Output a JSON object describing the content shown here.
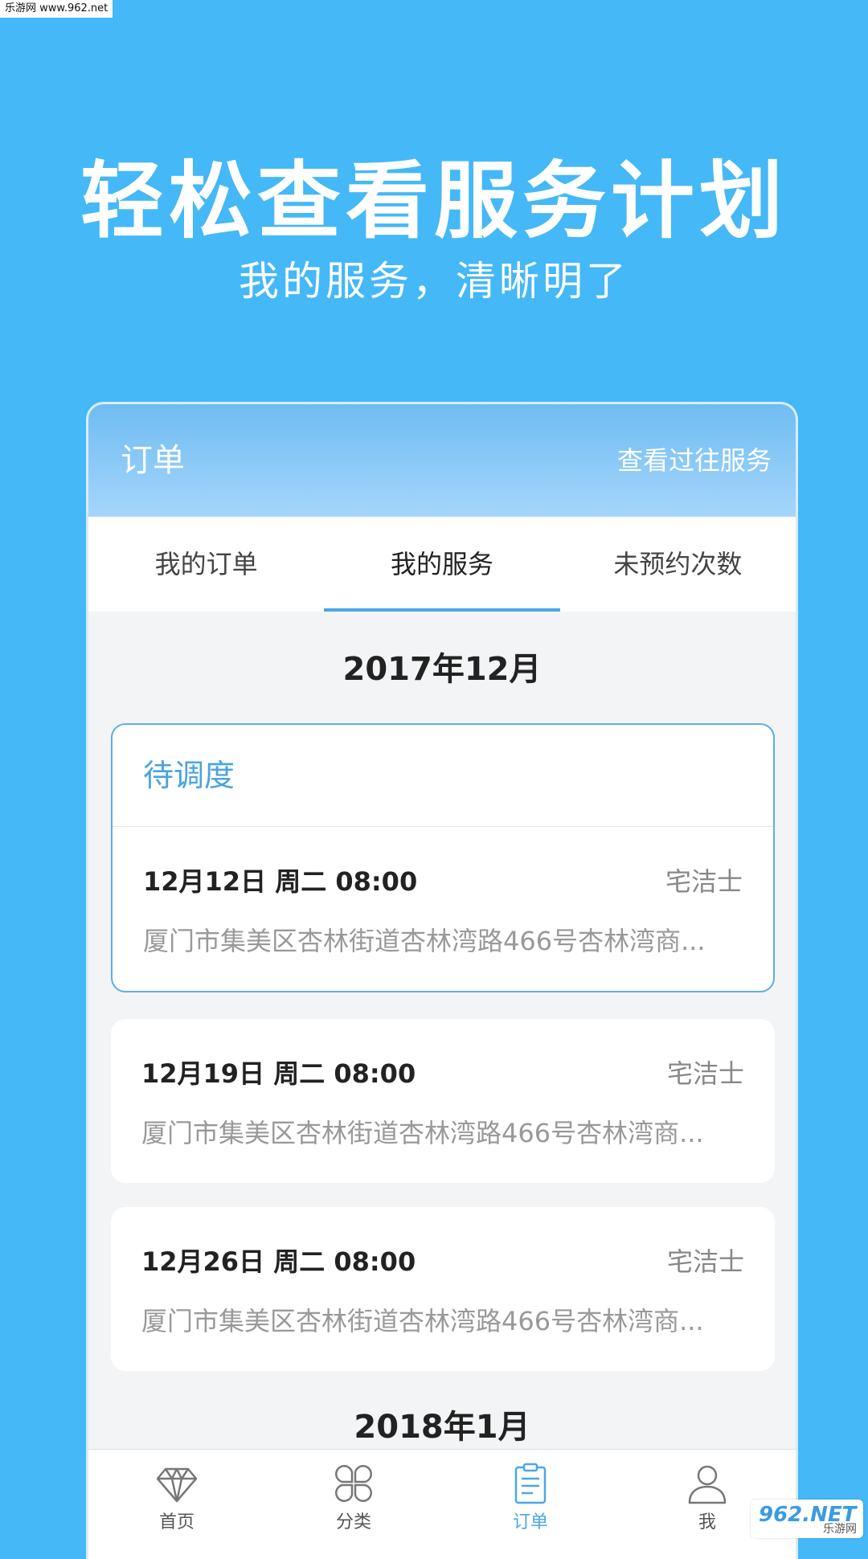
{
  "watermark": {
    "top_text": "乐游网 www.962.net",
    "bottom_logo": "962.NET",
    "bottom_cn": "乐游网"
  },
  "promo": {
    "headline": "轻松查看服务计划",
    "subline": "我的服务，清晰明了"
  },
  "app": {
    "title": "订单",
    "history_link": "查看过往服务",
    "tabs": [
      {
        "label": "我的订单",
        "active": false
      },
      {
        "label": "我的服务",
        "active": true
      },
      {
        "label": "未预约次数",
        "active": false
      }
    ],
    "sections": [
      {
        "month": "2017年12月",
        "cards": [
          {
            "status": "待调度",
            "date": "12月12日 周二 08:00",
            "provider": "宅洁士",
            "address": "厦门市集美区杏林街道杏林湾路466号杏林湾商..."
          },
          {
            "date": "12月19日 周二 08:00",
            "provider": "宅洁士",
            "address": "厦门市集美区杏林街道杏林湾路466号杏林湾商..."
          },
          {
            "date": "12月26日 周二 08:00",
            "provider": "宅洁士",
            "address": "厦门市集美区杏林街道杏林湾路466号杏林湾商..."
          }
        ]
      },
      {
        "month": "2018年1月"
      }
    ],
    "nav": [
      {
        "label": "首页",
        "icon": "diamond-icon",
        "active": false
      },
      {
        "label": "分类",
        "icon": "grid-petals-icon",
        "active": false
      },
      {
        "label": "订单",
        "icon": "clipboard-icon",
        "active": true
      },
      {
        "label": "我",
        "icon": "user-icon",
        "active": false
      }
    ]
  },
  "colors": {
    "background": "#45b8f7",
    "accent": "#4aa7e8",
    "status": "#4aa3e0"
  }
}
